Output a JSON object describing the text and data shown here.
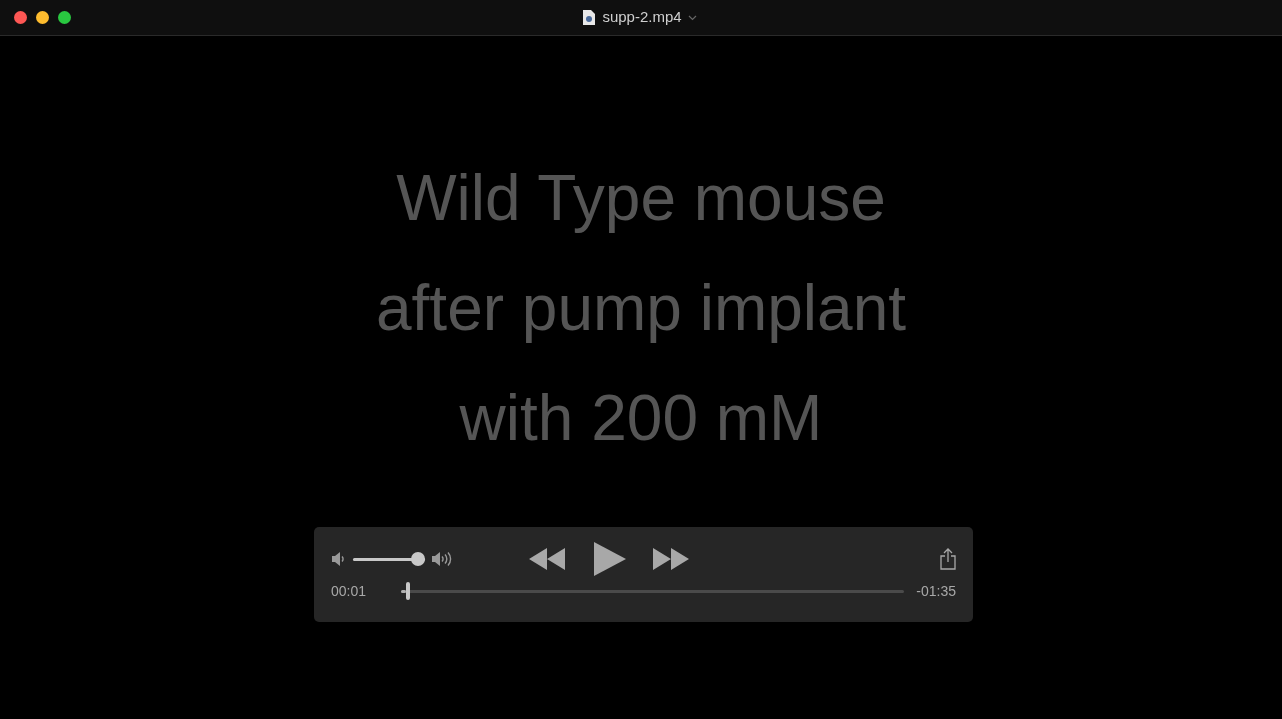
{
  "window": {
    "title": "supp-2.mp4"
  },
  "video": {
    "caption_lines": [
      "Wild Type mouse",
      "after pump implant",
      "with 200 mM"
    ]
  },
  "controls": {
    "volume": {
      "level": 1.0
    },
    "playing": false,
    "elapsed": "00:01",
    "remaining": "-01:35",
    "progress": {
      "level": 0.01
    }
  }
}
